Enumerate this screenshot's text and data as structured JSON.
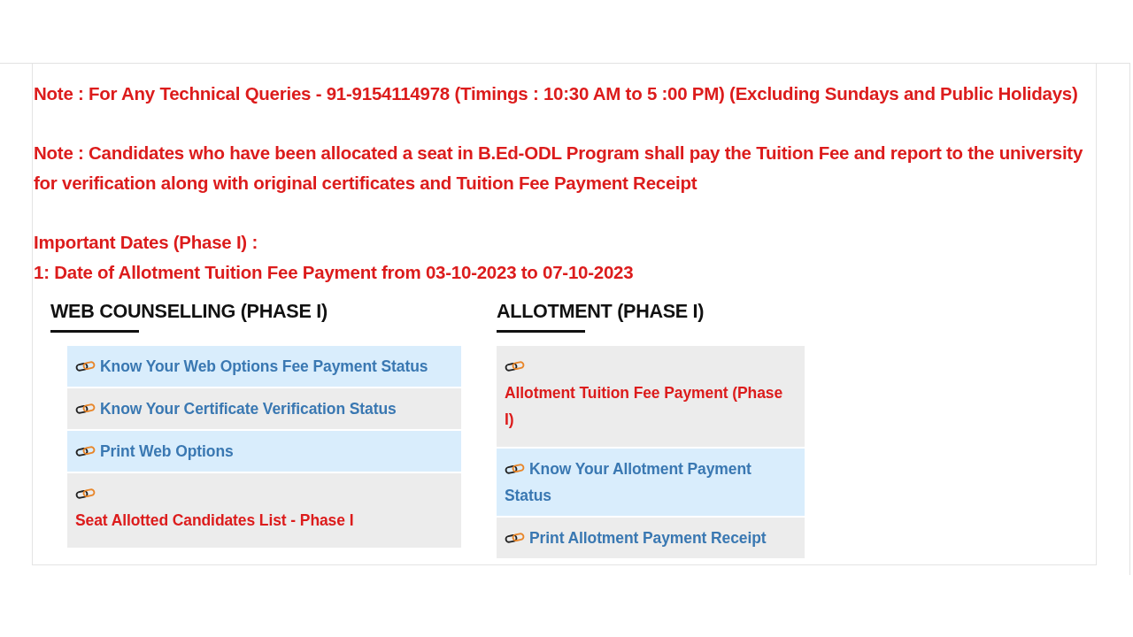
{
  "notes": [
    "Note : For Any Technical Queries - 91-9154114978 (Timings : 10:30 AM to 5 :00 PM) (Excluding Sundays and Public Holidays)",
    "Note : Candidates who have been allocated a seat in B.Ed-ODL Program shall pay the Tuition Fee and report to the university for verification along with original certificates and Tuition Fee Payment Receipt"
  ],
  "important_dates": {
    "title": "Important Dates (Phase I) :",
    "items": [
      "1: Date of Allotment Tuition Fee Payment from 03-10-2023 to 07-10-2023"
    ]
  },
  "sections": [
    {
      "title": "WEB COUNSELLING (PHASE I)",
      "links": [
        {
          "kind": "link",
          "label": "Know Your Web Options Fee Payment Status",
          "highlighted": true
        },
        {
          "kind": "link",
          "label": "Know Your Certificate Verification Status",
          "highlighted": false
        },
        {
          "kind": "link",
          "label": "Print Web Options",
          "highlighted": true
        },
        {
          "kind": "notice",
          "label": "Seat Allotted Candidates List - Phase I",
          "highlighted": false
        }
      ]
    },
    {
      "title": "ALLOTMENT (PHASE I)",
      "links": [
        {
          "kind": "notice",
          "label": "Allotment Tuition Fee Payment (Phase I)",
          "highlighted": false
        },
        {
          "kind": "link",
          "label": "Know Your Allotment Payment Status",
          "highlighted": true
        },
        {
          "kind": "link",
          "label": "Print Allotment Payment Receipt",
          "highlighted": false
        }
      ]
    }
  ]
}
